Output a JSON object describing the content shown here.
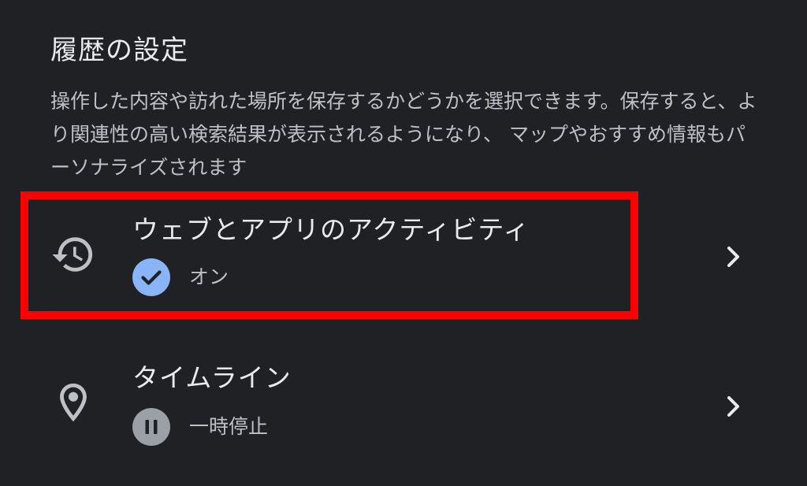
{
  "section": {
    "title": "履歴の設定",
    "description": "操作した内容や訪れた場所を保存するかどうかを選択できます。保存すると、より関連性の高い検索結果が表示されるようになり、 マップやおすすめ情報もパーソナライズされます"
  },
  "settings": [
    {
      "title": "ウェブとアプリのアクティビティ",
      "status": "オン",
      "icon": "history-icon",
      "status_icon": "check-circle-icon",
      "status_color": "#8ab4f8"
    },
    {
      "title": "タイムライン",
      "status": "一時停止",
      "icon": "location-pin-icon",
      "status_icon": "pause-circle-icon",
      "status_color": "#9aa0a6"
    }
  ],
  "colors": {
    "background": "#202124",
    "highlight": "#ff0000",
    "primary_text": "#e8eaed",
    "secondary_text": "#bdc1c6"
  }
}
